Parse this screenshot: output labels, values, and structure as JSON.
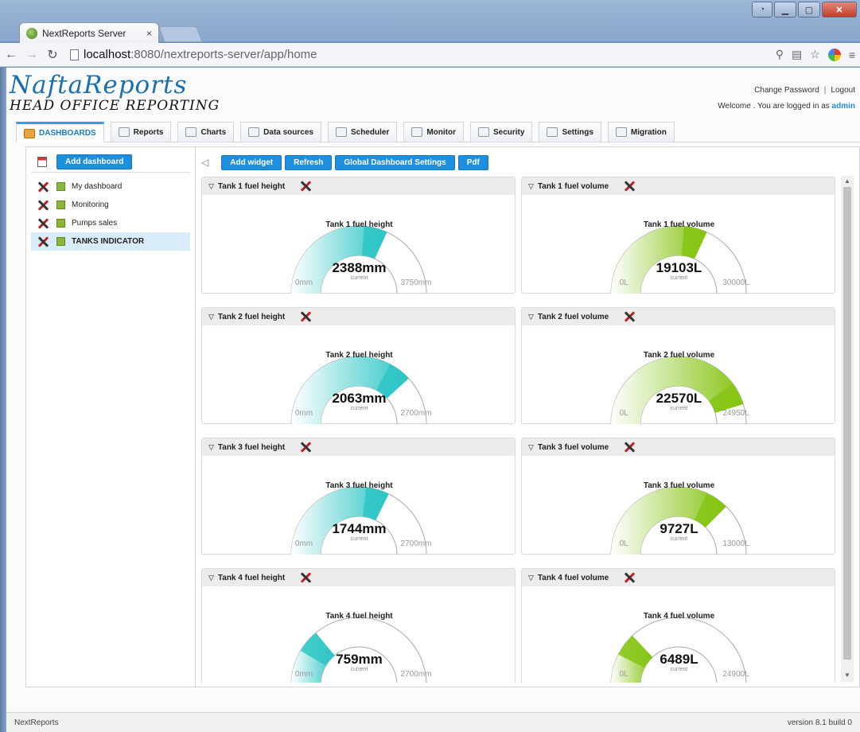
{
  "browser": {
    "tab_title": "NextReports Server",
    "tab_close": "×",
    "url_host": "localhost",
    "url_path": ":8080/nextreports-server/app/home"
  },
  "header": {
    "brand_name": "NaftaReports",
    "brand_sub": "HEAD OFFICE REPORTING",
    "change_password": "Change Password",
    "separator": "|",
    "logout": "Logout",
    "welcome": "Welcome . You are logged in as",
    "user": "admin"
  },
  "tabs": [
    {
      "label": "DASHBOARDS",
      "icon": "dashboards-icon",
      "active": true
    },
    {
      "label": "Reports",
      "icon": "reports-icon"
    },
    {
      "label": "Charts",
      "icon": "charts-icon"
    },
    {
      "label": "Data sources",
      "icon": "datasources-icon"
    },
    {
      "label": "Scheduler",
      "icon": "scheduler-icon"
    },
    {
      "label": "Monitor",
      "icon": "monitor-icon"
    },
    {
      "label": "Security",
      "icon": "security-icon"
    },
    {
      "label": "Settings",
      "icon": "settings-icon"
    },
    {
      "label": "Migration",
      "icon": "migration-icon"
    }
  ],
  "sidebar": {
    "add_dashboard": "Add dashboard",
    "items": [
      {
        "label": "My dashboard"
      },
      {
        "label": "Monitoring"
      },
      {
        "label": "Pumps sales"
      },
      {
        "label": "TANKS INDICATOR",
        "selected": true
      }
    ]
  },
  "toolbar": {
    "add_widget": "Add widget",
    "refresh": "Refresh",
    "global_settings": "Global Dashboard Settings",
    "pdf": "Pdf"
  },
  "colors": {
    "height_gauge": "#2fc6c6",
    "volume_gauge": "#86c414",
    "accent": "#1e8fdf"
  },
  "widgets": [
    {
      "title": "Tank 1 fuel height",
      "value": 2388,
      "display": "2388mm",
      "current": "current",
      "min": "0mm",
      "max": "3750mm",
      "maxv": 3750,
      "kind": "height"
    },
    {
      "title": "Tank 1 fuel volume",
      "value": 19103,
      "display": "19103L",
      "current": "current",
      "min": "0L",
      "max": "30000L",
      "maxv": 30000,
      "kind": "volume"
    },
    {
      "title": "Tank 2 fuel height",
      "value": 2063,
      "display": "2063mm",
      "current": "current",
      "min": "0mm",
      "max": "2700mm",
      "maxv": 2700,
      "kind": "height"
    },
    {
      "title": "Tank 2 fuel volume",
      "value": 22570,
      "display": "22570L",
      "current": "current",
      "min": "0L",
      "max": "24950L",
      "maxv": 24950,
      "kind": "volume"
    },
    {
      "title": "Tank 3 fuel height",
      "value": 1744,
      "display": "1744mm",
      "current": "current",
      "min": "0mm",
      "max": "2700mm",
      "maxv": 2700,
      "kind": "height"
    },
    {
      "title": "Tank 3 fuel volume",
      "value": 9727,
      "display": "9727L",
      "current": "current",
      "min": "0L",
      "max": "13000L",
      "maxv": 13000,
      "kind": "volume"
    },
    {
      "title": "Tank 4 fuel height",
      "value": 759,
      "display": "759mm",
      "current": "current",
      "min": "0mm",
      "max": "2700mm",
      "maxv": 2700,
      "kind": "height"
    },
    {
      "title": "Tank 4 fuel volume",
      "value": 6489,
      "display": "6489L",
      "current": "current",
      "min": "0L",
      "max": "24900L",
      "maxv": 24900,
      "kind": "volume"
    }
  ],
  "status": {
    "left": "NextReports",
    "right": "version 8.1 build 0"
  }
}
